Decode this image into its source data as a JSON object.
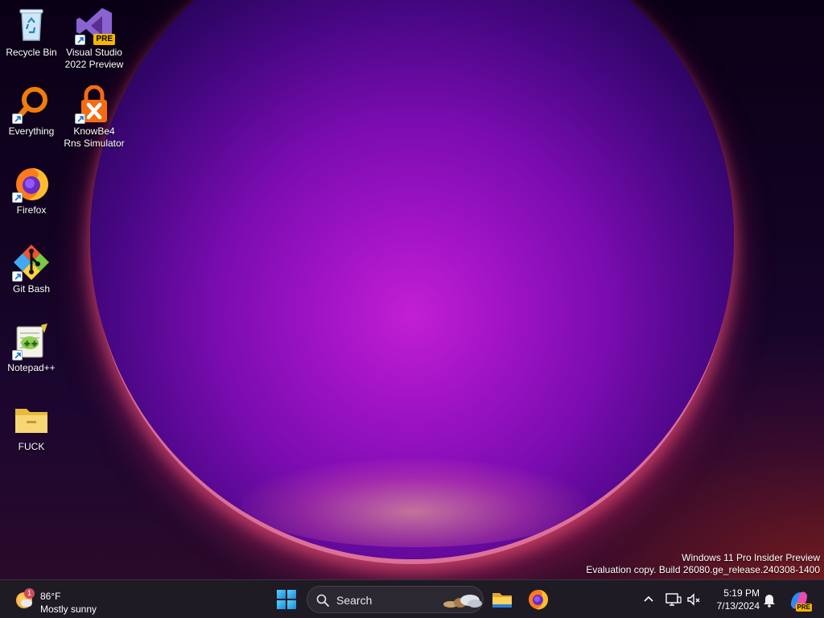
{
  "desktop": {
    "icons": [
      {
        "label": "Recycle Bin",
        "icon": "recycle-bin-icon"
      },
      {
        "label": "Visual Studio 2022 Preview",
        "icon": "visual-studio-icon",
        "badge": "PRE"
      },
      {
        "label": "Everything",
        "icon": "magnifier-icon"
      },
      {
        "label": "KnowBe4 Rns Simulator",
        "icon": "padlock-icon"
      },
      {
        "label": "Firefox",
        "icon": "firefox-icon"
      },
      {
        "label": "Git Bash",
        "icon": "git-icon"
      },
      {
        "label": "Notepad++",
        "icon": "notepad-plus-plus-icon"
      },
      {
        "label": "FUCK",
        "icon": "folder-icon"
      }
    ],
    "watermark": {
      "line1": "Windows 11 Pro Insider Preview",
      "line2": "Evaluation copy. Build 26080.ge_release.240308-1400"
    }
  },
  "taskbar": {
    "weather": {
      "temperature": "86°F",
      "condition": "Mostly sunny",
      "badge": "1"
    },
    "search": {
      "label": "Search"
    },
    "apps": [
      "windows-start-icon",
      "file-explorer-icon",
      "firefox-icon"
    ],
    "tray": [
      "chevron-up-icon",
      "network-icon",
      "volume-muted-icon"
    ],
    "clock": {
      "time": "5:19 PM",
      "date": "7/13/2024"
    },
    "copilot_badge": "PRE"
  },
  "colors": {
    "taskbar_bg": "#1f1b24",
    "accent_start": "#1a8ad8"
  }
}
